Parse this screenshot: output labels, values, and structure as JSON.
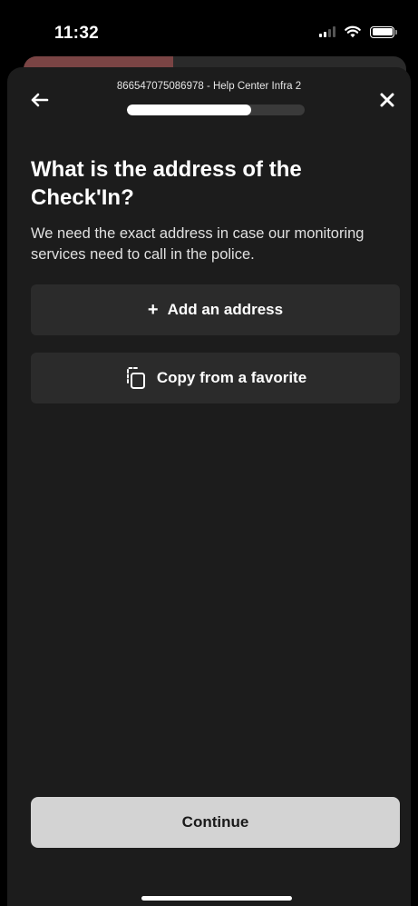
{
  "status_bar": {
    "time": "11:32"
  },
  "header": {
    "subtitle": "866547075086978 - Help Center Infra 2",
    "progress": 0.7
  },
  "main": {
    "title": "What is the address of the Check'In?",
    "description": "We need the exact address in case our monitoring services need to call in the police.",
    "add_address_label": "Add an address",
    "add_address_icon": "plus-icon",
    "copy_favorite_label": "Copy from a favorite",
    "copy_favorite_icon": "copy-icon"
  },
  "footer": {
    "continue_label": "Continue"
  }
}
